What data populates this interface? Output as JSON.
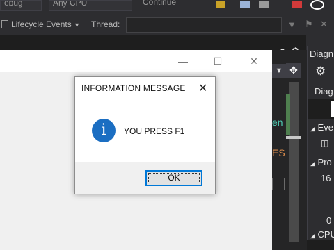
{
  "toolbar": {
    "config_partial": "ebug",
    "platform_partial": "Any CPU",
    "continue_partial": "Continue",
    "lifecycle_label": "Lifecycle Events",
    "thread_label": "Thread:"
  },
  "diagnostics": {
    "title_partial": "Diagn",
    "tab_partial": "Diag",
    "events_partial": "Eve",
    "process_partial": "Pro",
    "value_16": "16",
    "value_0": "0",
    "cpu_partial": "CPU"
  },
  "output_fragments": {
    "green_text": "en",
    "orange_text": "ES"
  },
  "dialog": {
    "title": "INFORMATION MESSAGE",
    "message": "YOU PRESS F1",
    "ok_label": "OK",
    "close_glyph": "✕",
    "icon_glyph": "i"
  },
  "app_window": {
    "minimize_glyph": "—",
    "maximize_glyph": "☐",
    "close_glyph": "✕"
  },
  "colors": {
    "accent": "#0078d7",
    "info_icon": "#1b6ec2",
    "vs_dark": "#2d2d30"
  }
}
